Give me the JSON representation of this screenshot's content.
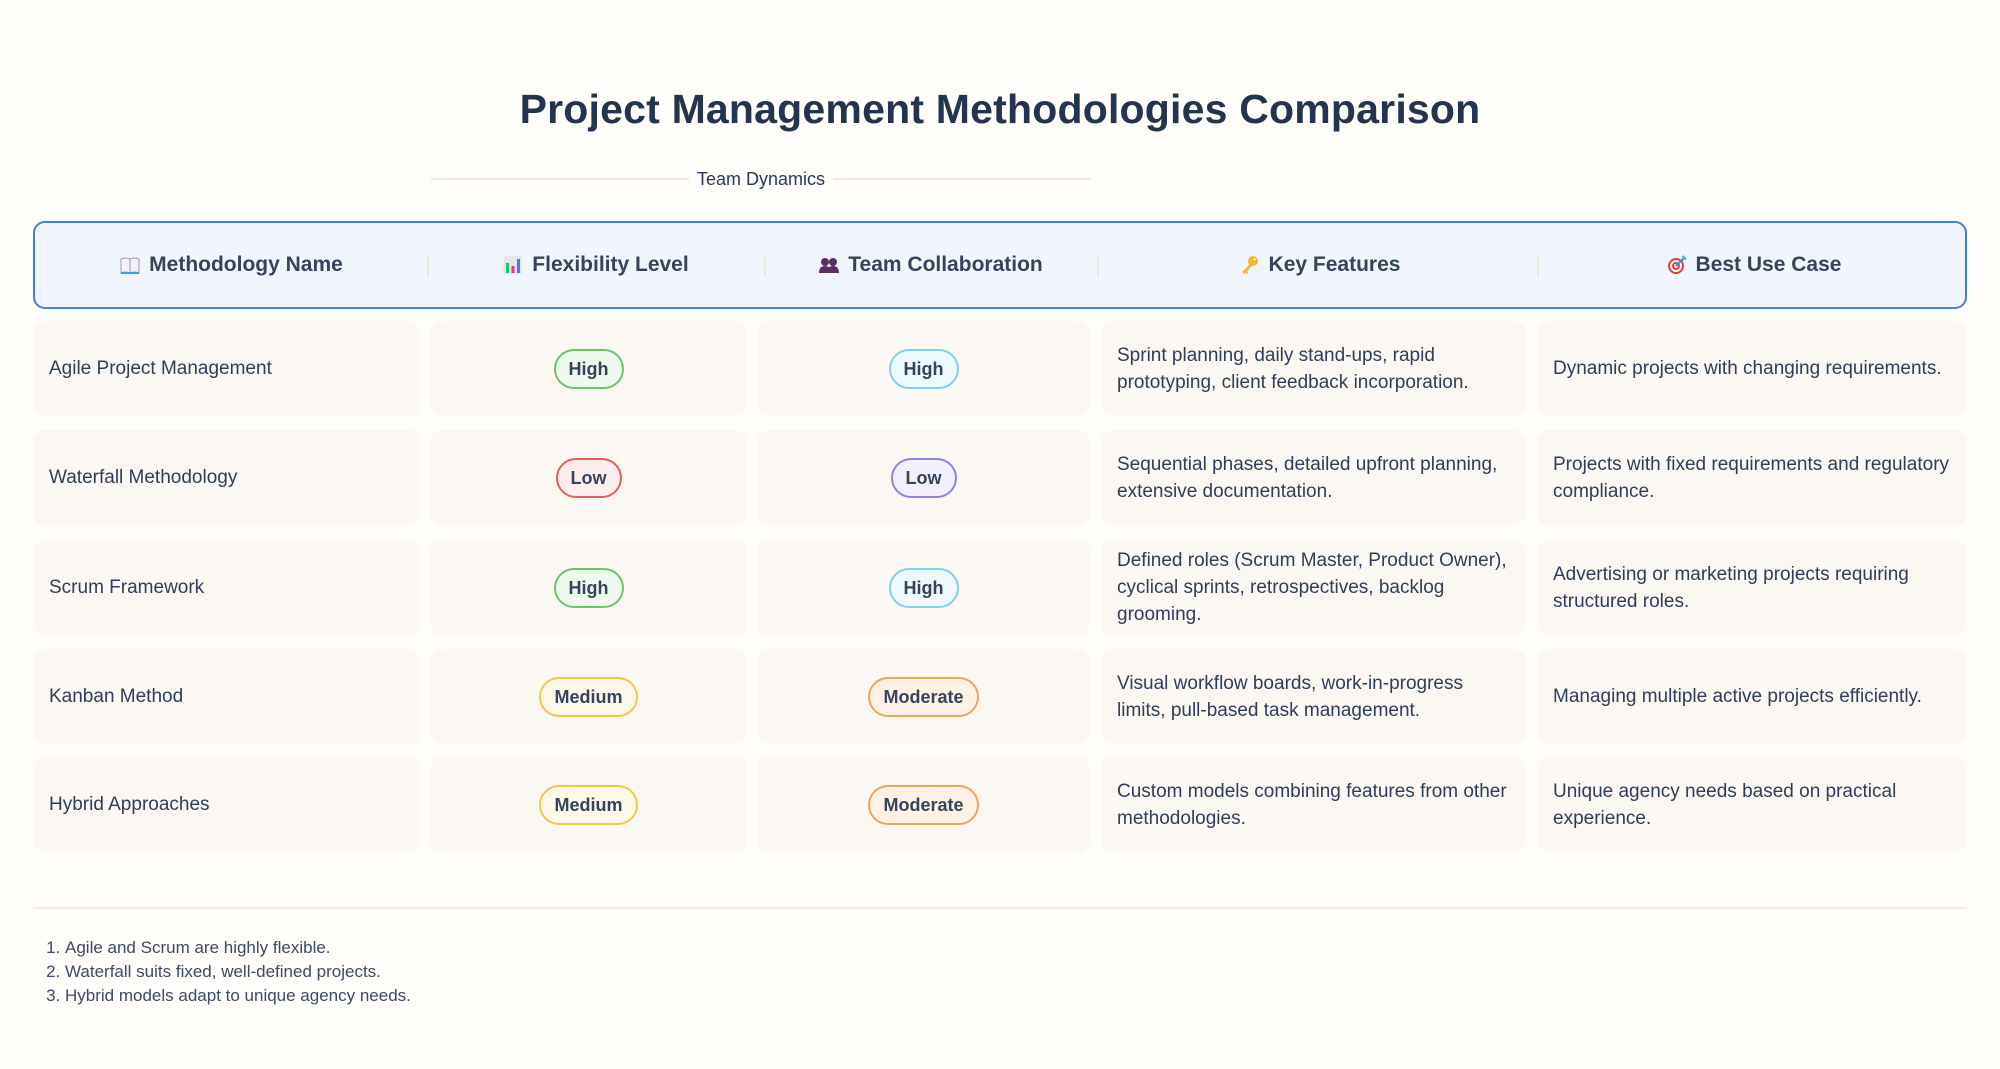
{
  "title": "Project Management Methodologies Comparison",
  "subtitle": "Team Dynamics",
  "columns": [
    {
      "label": "Methodology Name",
      "icon": "open-book-icon"
    },
    {
      "label": "Flexibility Level",
      "icon": "bar-chart-icon"
    },
    {
      "label": "Team Collaboration",
      "icon": "people-icon"
    },
    {
      "label": "Key Features",
      "icon": "key-icon"
    },
    {
      "label": "Best Use Case",
      "icon": "target-icon"
    }
  ],
  "colors": {
    "header_border": "#3d82d6",
    "header_bg": "#f1f6fe",
    "high_flex": "#6cc46a",
    "high_team": "#7fd0ec",
    "low_flex": "#e85c5c",
    "low_team": "#8f83ea",
    "medium": "#f3c64e",
    "moderate": "#f0a35a"
  },
  "rows": [
    {
      "name": "Agile Project Management",
      "flexibility": "High",
      "collaboration": "High",
      "features": "Sprint planning, daily stand-ups, rapid prototyping, client feedback incorporation.",
      "use_case": "Dynamic projects with changing requirements."
    },
    {
      "name": "Waterfall Methodology",
      "flexibility": "Low",
      "collaboration": "Low",
      "features": "Sequential phases, detailed upfront planning, extensive documentation.",
      "use_case": "Projects with fixed requirements and regulatory compliance."
    },
    {
      "name": "Scrum Framework",
      "flexibility": "High",
      "collaboration": "High",
      "features": "Defined roles (Scrum Master, Product Owner), cyclical sprints, retrospectives, backlog grooming.",
      "use_case": "Advertising or marketing projects requiring structured roles."
    },
    {
      "name": "Kanban Method",
      "flexibility": "Medium",
      "collaboration": "Moderate",
      "features": "Visual workflow boards, work-in-progress limits, pull-based task management.",
      "use_case": "Managing multiple active projects efficiently."
    },
    {
      "name": "Hybrid Approaches",
      "flexibility": "Medium",
      "collaboration": "Moderate",
      "features": "Custom models combining features from other methodologies.",
      "use_case": "Unique agency needs based on practical experience."
    }
  ],
  "notes": [
    "Agile and Scrum are highly flexible.",
    "Waterfall suits fixed, well-defined projects.",
    "Hybrid models adapt to unique agency needs."
  ]
}
